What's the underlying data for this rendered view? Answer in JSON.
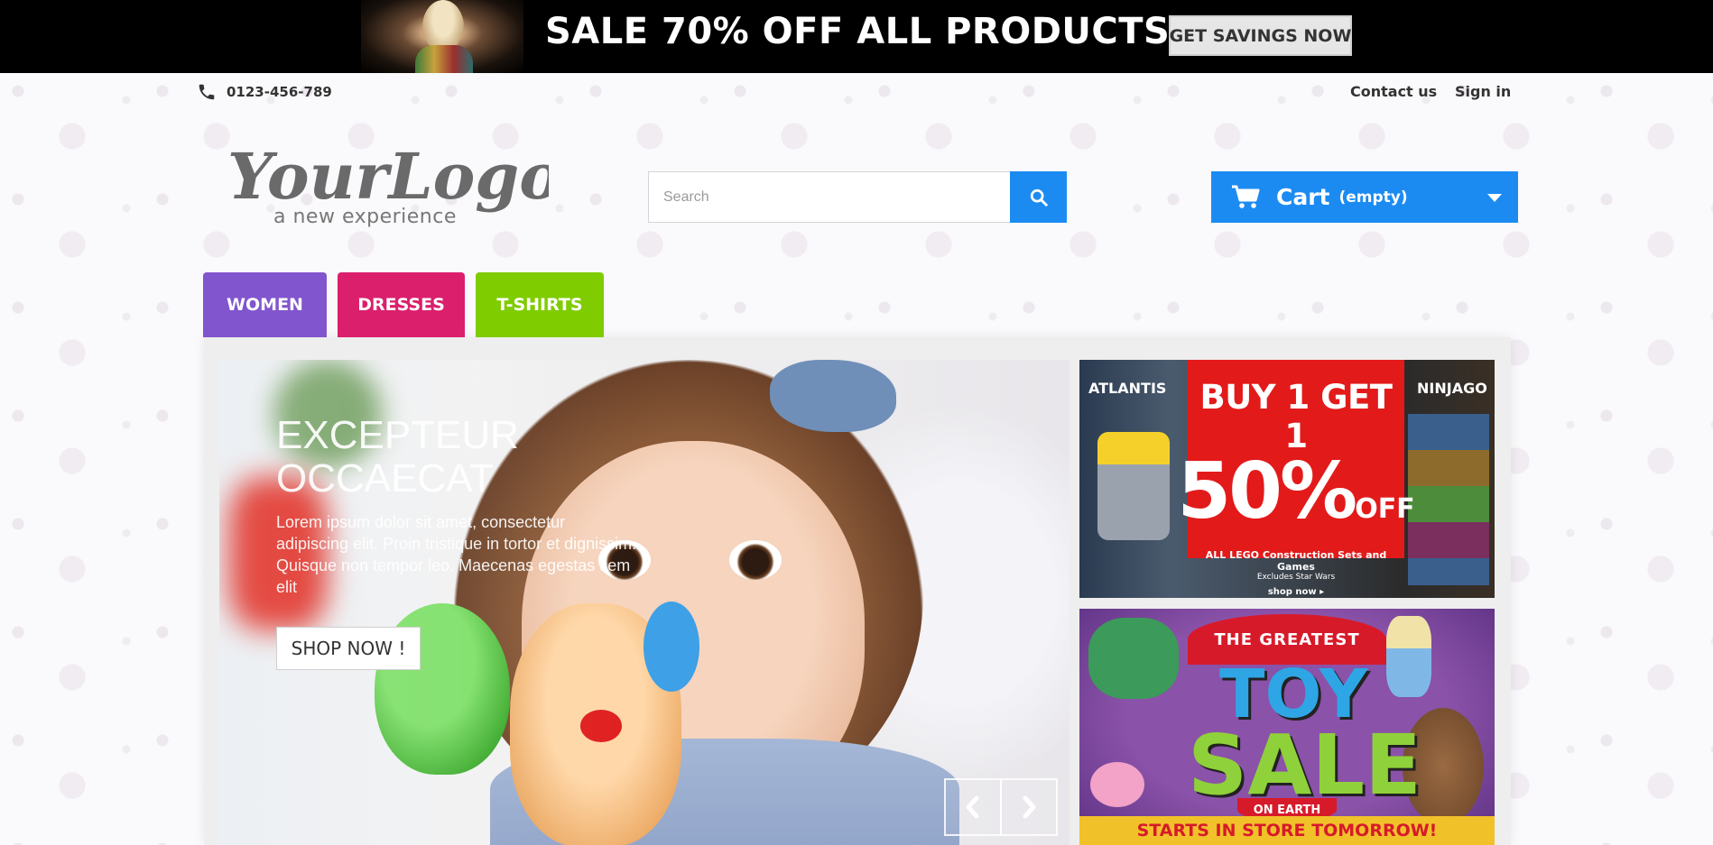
{
  "banner": {
    "headline": "SALE 70% OFF ALL PRODUCTS",
    "cta": "GET SAVINGS NOW"
  },
  "header": {
    "phone": "0123-456-789",
    "links": [
      "Contact us",
      "Sign in"
    ],
    "logo_text": "YourLogo",
    "logo_tagline": "a new experience",
    "search_placeholder": "Search",
    "cart_label": "Cart",
    "cart_state": "(empty)"
  },
  "menu": {
    "tabs": [
      {
        "label": "WOMEN",
        "color": "#8155cd"
      },
      {
        "label": "DRESSES",
        "color": "#db1f6c"
      },
      {
        "label": "T-SHIRTS",
        "color": "#7fcc00"
      }
    ]
  },
  "slider": {
    "title": "EXCEPTEUR OCCAECAT",
    "text": "Lorem ipsum dolor sit amet, consectetur adipiscing elit. Proin tristique in tortor et dignissim. Quisque non tempor leo. Maecenas egestas sem elit",
    "button": "SHOP NOW !"
  },
  "promo_lego": {
    "line1": "BUY 1 GET 1",
    "line2": "50%",
    "line2_suffix": "OFF",
    "line3": "ALL LEGO Construction Sets and Games",
    "line4": "Excludes Star Wars",
    "line5": "shop now ▸",
    "brands": [
      "ATLANTIS",
      "NINJAGO"
    ]
  },
  "promo_toy": {
    "ribbon": "THE GREATEST",
    "word1": "TOY",
    "word2": "SALE",
    "subtitle": "ON EARTH",
    "footer": "STARTS IN STORE TOMORROW!"
  },
  "colors": {
    "accent_blue": "#1b8bf2",
    "banner_bg": "#000000"
  }
}
